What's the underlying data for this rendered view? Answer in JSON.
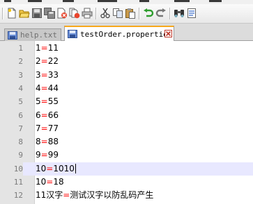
{
  "toolbar": {
    "buttons": [
      {
        "name": "new-file-icon"
      },
      {
        "name": "open-file-icon"
      },
      {
        "name": "save-icon"
      },
      {
        "name": "save-all-icon"
      },
      {
        "name": "close-file-icon"
      },
      {
        "name": "close-all-icon"
      },
      {
        "name": "print-icon"
      },
      {
        "name": "cut-icon"
      },
      {
        "name": "copy-icon"
      },
      {
        "name": "paste-icon"
      },
      {
        "name": "undo-icon"
      },
      {
        "name": "redo-icon"
      },
      {
        "name": "find-icon"
      },
      {
        "name": "replace-icon"
      }
    ]
  },
  "tabs": [
    {
      "label": "help.txt",
      "active": false
    },
    {
      "label": "testOrder.properties",
      "active": true
    }
  ],
  "editor": {
    "current_line": 10,
    "lines": [
      {
        "num": "1",
        "key": "1",
        "eq": "=",
        "value": "11"
      },
      {
        "num": "2",
        "key": "2",
        "eq": "=",
        "value": "22"
      },
      {
        "num": "3",
        "key": "3",
        "eq": "=",
        "value": "33"
      },
      {
        "num": "4",
        "key": "4",
        "eq": "=",
        "value": "44"
      },
      {
        "num": "5",
        "key": "5",
        "eq": "=",
        "value": "55"
      },
      {
        "num": "6",
        "key": "6",
        "eq": "=",
        "value": "66"
      },
      {
        "num": "7",
        "key": "7",
        "eq": "=",
        "value": "77"
      },
      {
        "num": "8",
        "key": "8",
        "eq": "=",
        "value": "88"
      },
      {
        "num": "9",
        "key": "9",
        "eq": "=",
        "value": "99"
      },
      {
        "num": "10",
        "key": "10",
        "eq": "=",
        "value": "1010"
      },
      {
        "num": "11",
        "key": "10",
        "eq": "=",
        "value": "18"
      },
      {
        "num": "12",
        "key": "11汉字",
        "eq": "=",
        "value": "测试汉字以防乱码产生"
      }
    ]
  },
  "colors": {
    "equals": "#ff0000",
    "active_tab_accent": "#f7a81c",
    "current_line_bg": "#e8e8ff",
    "gutter_bg": "#e4e4e4"
  }
}
